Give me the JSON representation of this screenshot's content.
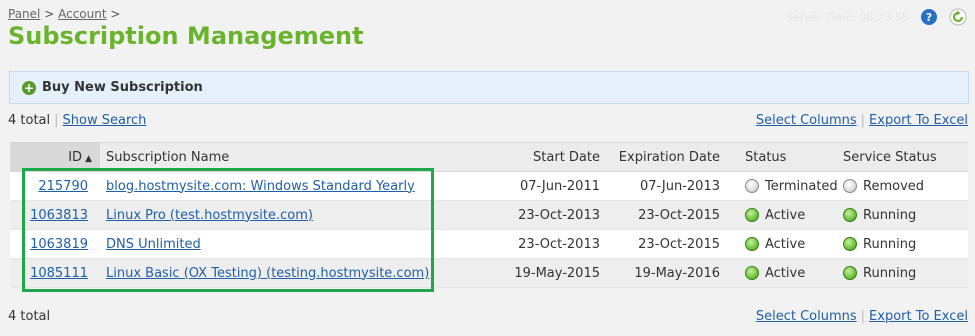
{
  "breadcrumb": {
    "items": [
      "Panel",
      "Account"
    ],
    "separator": ">"
  },
  "header": {
    "server_time": "Server Time: 08:23:55",
    "help_symbol": "?",
    "title": "Subscription Management"
  },
  "actions": {
    "buy_label": "Buy New Subscription"
  },
  "toolbar_top": {
    "total": "4 total",
    "show_search": "Show Search",
    "select_columns": "Select Columns",
    "export": "Export To Excel"
  },
  "table": {
    "headers": {
      "id": "ID",
      "name": "Subscription Name",
      "start": "Start Date",
      "expiration": "Expiration Date",
      "status": "Status",
      "service_status": "Service Status"
    },
    "sort_indicator": "▲",
    "rows": [
      {
        "id": "215790",
        "name": "blog.hostmysite.com: Windows Standard Yearly",
        "start": "07-Jun-2011",
        "expiration": "07-Jun-2013",
        "status": "Terminated",
        "status_color": "grey",
        "service_status": "Removed",
        "service_color": "grey"
      },
      {
        "id": "1063813",
        "name": "Linux Pro (test.hostmysite.com)",
        "start": "23-Oct-2013",
        "expiration": "23-Oct-2015",
        "status": "Active",
        "status_color": "green",
        "service_status": "Running",
        "service_color": "green"
      },
      {
        "id": "1063819",
        "name": "DNS Unlimited",
        "start": "23-Oct-2013",
        "expiration": "23-Oct-2015",
        "status": "Active",
        "status_color": "green",
        "service_status": "Running",
        "service_color": "green"
      },
      {
        "id": "1085111",
        "name": "Linux Basic (OX Testing) (testing.hostmysite.com)",
        "start": "19-May-2015",
        "expiration": "19-May-2016",
        "status": "Active",
        "status_color": "green",
        "service_status": "Running",
        "service_color": "green"
      }
    ]
  },
  "toolbar_bottom": {
    "total": "4 total",
    "select_columns": "Select Columns",
    "export": "Export To Excel"
  },
  "colors": {
    "title_green": "#6ab42d",
    "link_blue": "#1f5fa6",
    "highlight_green": "#1fa84a",
    "buy_bar_bg": "#e6f0fa"
  },
  "icons": {
    "help": "help-icon",
    "refresh": "refresh-icon",
    "add": "plus-circle-icon",
    "sort": "sort-ascending-icon",
    "status": "status-dot-icon"
  }
}
